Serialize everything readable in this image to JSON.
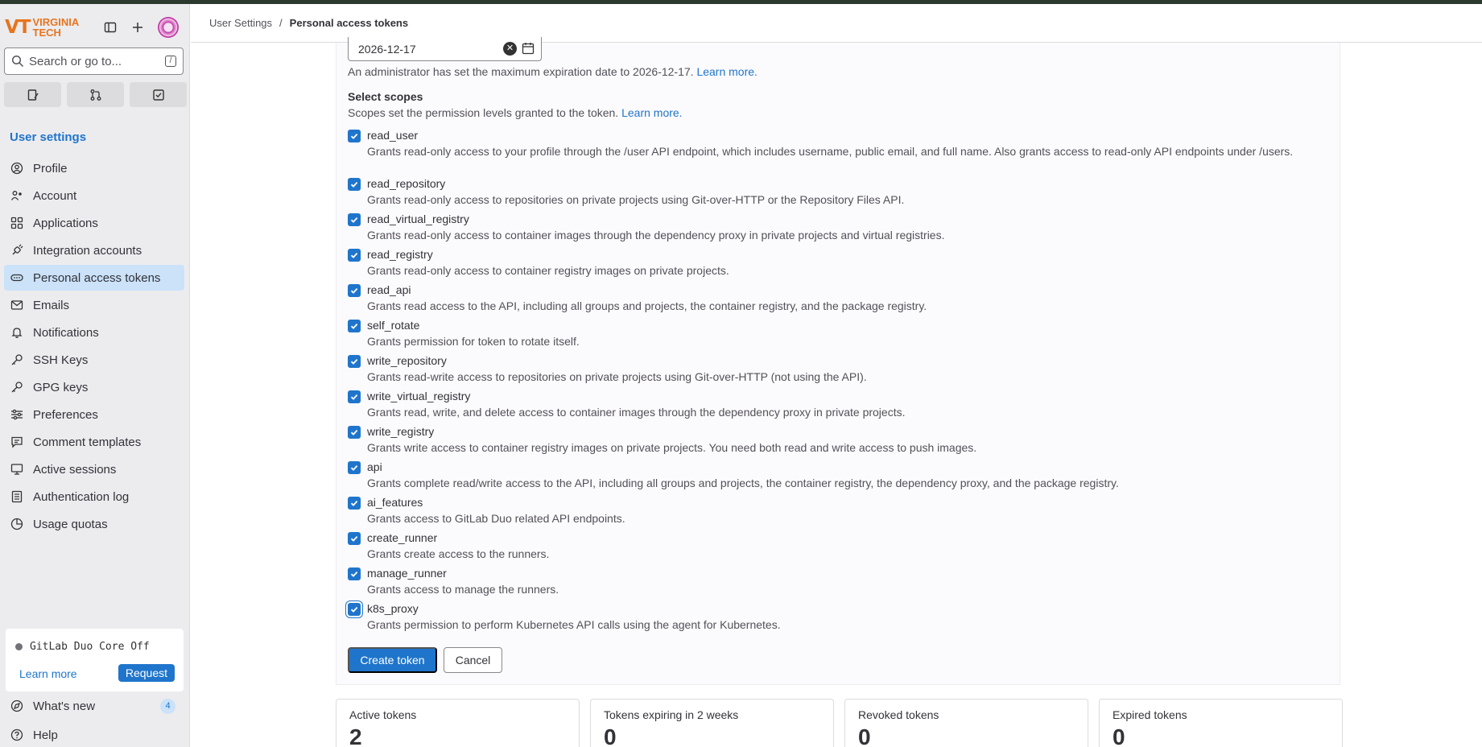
{
  "brand": {
    "name_line1": "VIRGINIA",
    "name_line2": "TECH",
    "mark": "VT",
    "color": "#e5751f"
  },
  "search": {
    "placeholder": "Search or go to...",
    "shortcut": "/"
  },
  "sidebar": {
    "section_title": "User settings",
    "items": [
      {
        "label": "Profile",
        "icon": "profile-icon"
      },
      {
        "label": "Account",
        "icon": "account-icon"
      },
      {
        "label": "Applications",
        "icon": "applications-icon"
      },
      {
        "label": "Integration accounts",
        "icon": "integration-icon"
      },
      {
        "label": "Personal access tokens",
        "icon": "token-icon",
        "active": true
      },
      {
        "label": "Emails",
        "icon": "email-icon"
      },
      {
        "label": "Notifications",
        "icon": "bell-icon"
      },
      {
        "label": "SSH Keys",
        "icon": "key-icon"
      },
      {
        "label": "GPG keys",
        "icon": "key-icon"
      },
      {
        "label": "Preferences",
        "icon": "preferences-icon"
      },
      {
        "label": "Comment templates",
        "icon": "comment-icon"
      },
      {
        "label": "Active sessions",
        "icon": "monitor-icon"
      },
      {
        "label": "Authentication log",
        "icon": "log-icon"
      },
      {
        "label": "Usage quotas",
        "icon": "quota-icon"
      }
    ],
    "duo": {
      "title": "GitLab Duo Core Off",
      "learn_more": "Learn more",
      "request": "Request"
    },
    "whats_new": {
      "label": "What's new",
      "count": "4"
    },
    "help": {
      "label": "Help"
    }
  },
  "breadcrumb": {
    "parent": "User Settings",
    "separator": "/",
    "current": "Personal access tokens"
  },
  "expiration": {
    "value": "2026-12-17",
    "note": "An administrator has set the maximum expiration date to 2026-12-17.",
    "learn_more": "Learn more."
  },
  "scopes": {
    "title": "Select scopes",
    "description": "Scopes set the permission levels granted to the token.",
    "learn_more": "Learn more.",
    "items": [
      {
        "name": "read_user",
        "desc": "Grants read-only access to your profile through the /user API endpoint, which includes username, public email, and full name. Also grants access to read-only API endpoints under /users."
      },
      {
        "name": "read_repository",
        "desc": "Grants read-only access to repositories on private projects using Git-over-HTTP or the Repository Files API."
      },
      {
        "name": "read_virtual_registry",
        "desc": "Grants read-only access to container images through the dependency proxy in private projects and virtual registries."
      },
      {
        "name": "read_registry",
        "desc": "Grants read-only access to container registry images on private projects."
      },
      {
        "name": "read_api",
        "desc": "Grants read access to the API, including all groups and projects, the container registry, and the package registry."
      },
      {
        "name": "self_rotate",
        "desc": "Grants permission for token to rotate itself."
      },
      {
        "name": "write_repository",
        "desc": "Grants read-write access to repositories on private projects using Git-over-HTTP (not using the API)."
      },
      {
        "name": "write_virtual_registry",
        "desc": "Grants read, write, and delete access to container images through the dependency proxy in private projects."
      },
      {
        "name": "write_registry",
        "desc": "Grants write access to container registry images on private projects. You need both read and write access to push images."
      },
      {
        "name": "api",
        "desc": "Grants complete read/write access to the API, including all groups and projects, the container registry, the dependency proxy, and the package registry."
      },
      {
        "name": "ai_features",
        "desc": "Grants access to GitLab Duo related API endpoints."
      },
      {
        "name": "create_runner",
        "desc": "Grants create access to the runners."
      },
      {
        "name": "manage_runner",
        "desc": "Grants access to manage the runners."
      },
      {
        "name": "k8s_proxy",
        "desc": "Grants permission to perform Kubernetes API calls using the agent for Kubernetes."
      }
    ]
  },
  "actions": {
    "create": "Create token",
    "cancel": "Cancel"
  },
  "stats": [
    {
      "label": "Active tokens",
      "value": "2"
    },
    {
      "label": "Tokens expiring in 2 weeks",
      "value": "0"
    },
    {
      "label": "Revoked tokens",
      "value": "0"
    },
    {
      "label": "Expired tokens",
      "value": "0"
    }
  ],
  "colors": {
    "accent": "#1f75cb",
    "active_nav": "#cbe2f9",
    "sidebar_bg": "#ececef"
  }
}
